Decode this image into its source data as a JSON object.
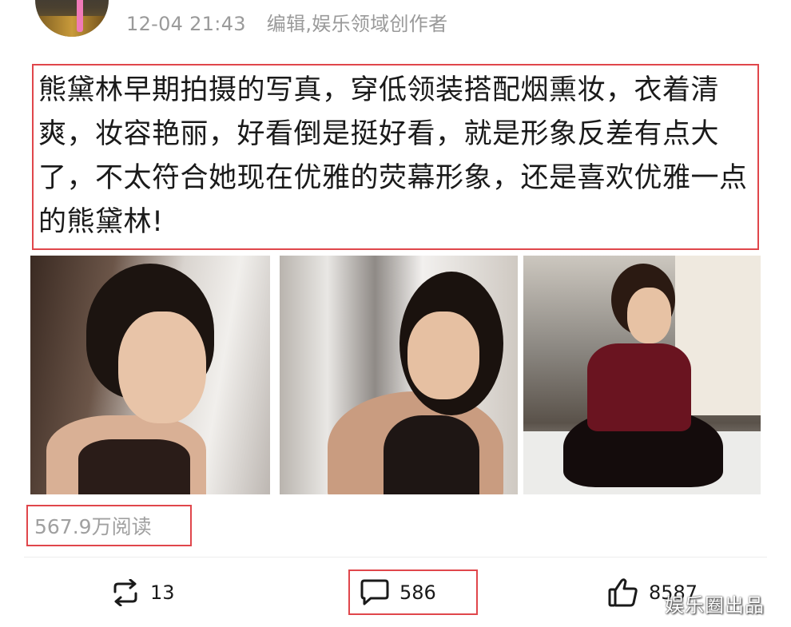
{
  "post": {
    "time": "12-04 21:43",
    "source": "编辑,娱乐领域创作者",
    "text": "熊黛林早期拍摄的写真，穿低领装搭配烟熏妆，衣着清爽，妆容艳丽，好看倒是挺好看，就是形象反差有点大了，不太符合她现在优雅的荧幕形象，还是喜欢优雅一点的熊黛林!",
    "reads": "567.9万阅读"
  },
  "actions": {
    "repost_count": "13",
    "comment_count": "586",
    "like_count": "8587"
  },
  "icons": {
    "repost": "repost-icon",
    "comment": "comment-icon",
    "like": "thumbs-up-icon"
  },
  "watermark": "娱乐圈出品",
  "colors": {
    "highlight_box": "#e0464b",
    "meta_text": "#9a9a9a"
  }
}
